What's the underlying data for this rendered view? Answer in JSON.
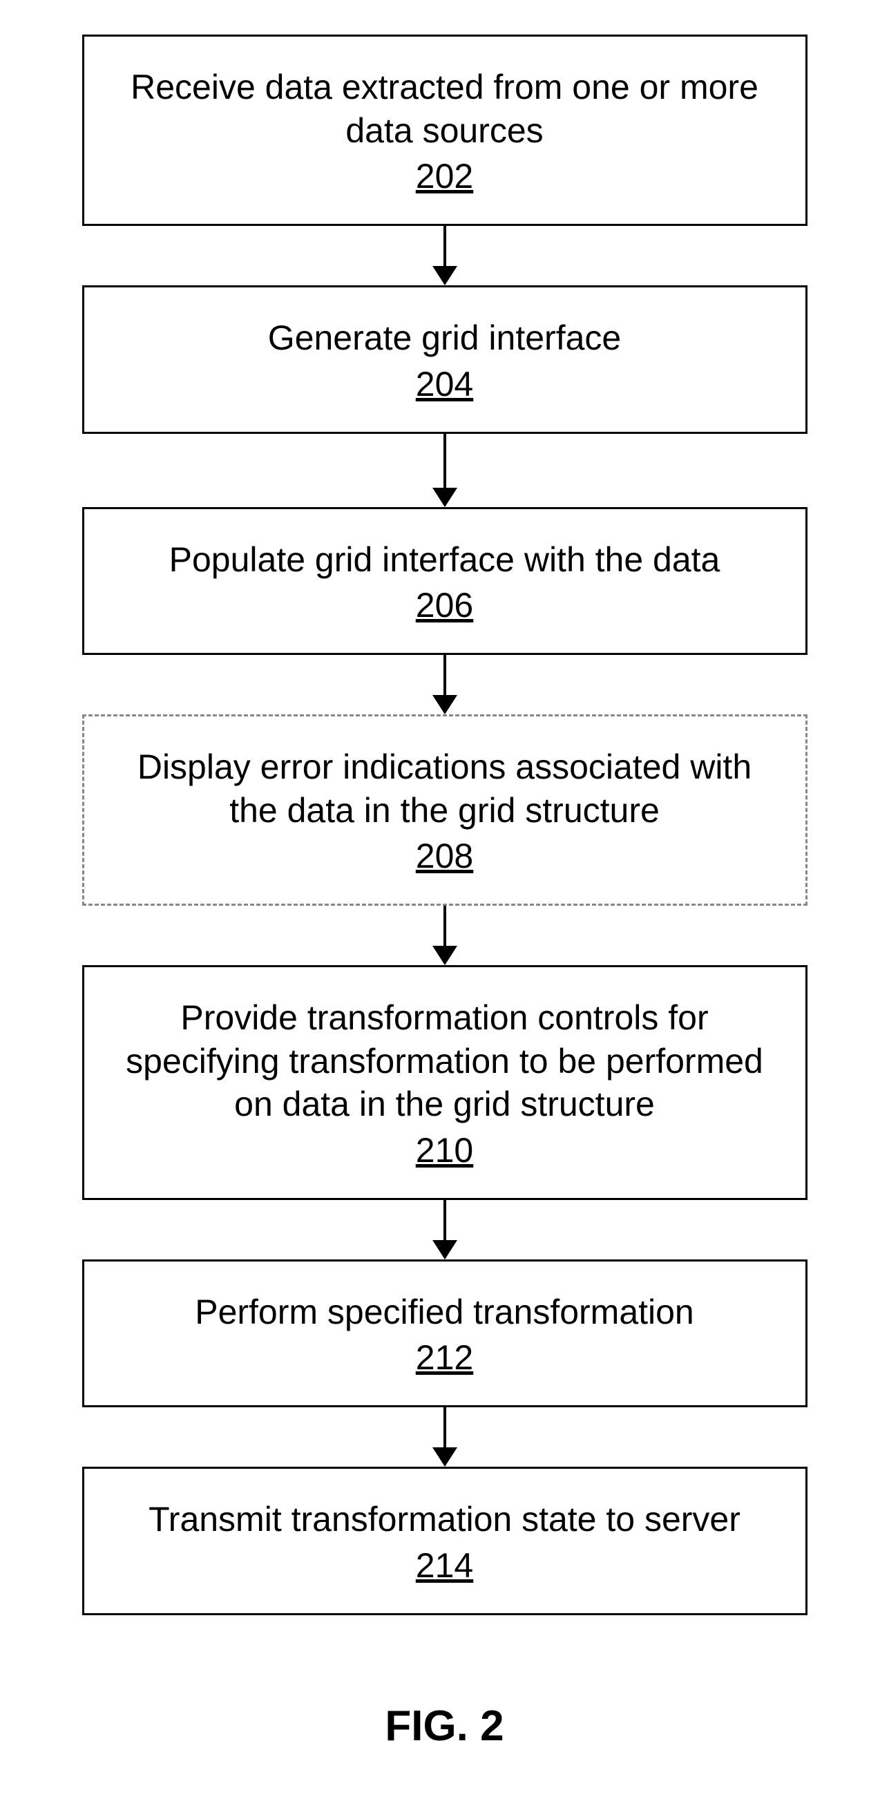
{
  "figure_label": "FIG. 2",
  "steps": [
    {
      "label": "Receive data extracted from one or more data sources",
      "ref": "202",
      "dashed": false
    },
    {
      "label": "Generate grid interface",
      "ref": "204",
      "dashed": false
    },
    {
      "label": "Populate grid interface with the data",
      "ref": "206",
      "dashed": false
    },
    {
      "label": "Display error indications associated with the data in the grid structure",
      "ref": "208",
      "dashed": true
    },
    {
      "label": "Provide transformation controls for specifying transformation to be performed on data in the grid structure",
      "ref": "210",
      "dashed": false
    },
    {
      "label": "Perform specified transformation",
      "ref": "212",
      "dashed": false
    },
    {
      "label": "Transmit transformation state to server",
      "ref": "214",
      "dashed": false
    }
  ],
  "arrow_heights": [
    58,
    78,
    58,
    58,
    58,
    58
  ]
}
